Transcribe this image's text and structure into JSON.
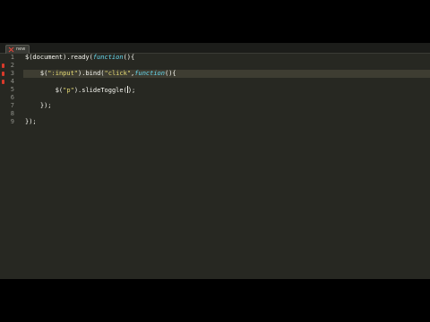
{
  "tab": {
    "label": "new"
  },
  "editor": {
    "colors": {
      "background": "#272822",
      "text": "#f8f8f2",
      "string": "#e6db74",
      "keyword": "#66d9ef",
      "line_number": "#8f908a",
      "marker": "#d93a2b",
      "current_line": "#3e3d32"
    },
    "current_line": 3,
    "lines": [
      {
        "number": "1",
        "has_marker": false,
        "tokens": [
          {
            "t": "$(document).ready(",
            "c": "plain"
          },
          {
            "t": "function",
            "c": "kw"
          },
          {
            "t": "(){",
            "c": "plain"
          }
        ]
      },
      {
        "number": "2",
        "has_marker": true,
        "tokens": []
      },
      {
        "number": "3",
        "has_marker": true,
        "tokens": [
          {
            "t": "    $(",
            "c": "plain"
          },
          {
            "t": "\":input\"",
            "c": "str"
          },
          {
            "t": ").bind(",
            "c": "plain"
          },
          {
            "t": "\"click\"",
            "c": "str"
          },
          {
            "t": ",",
            "c": "plain"
          },
          {
            "t": "function",
            "c": "kw"
          },
          {
            "t": "(){",
            "c": "plain"
          }
        ]
      },
      {
        "number": "4",
        "has_marker": true,
        "tokens": []
      },
      {
        "number": "5",
        "has_marker": false,
        "tokens": [
          {
            "t": "        $(",
            "c": "plain"
          },
          {
            "t": "\"p\"",
            "c": "str"
          },
          {
            "t": ").slideToggle(",
            "c": "plain"
          },
          {
            "t": "",
            "c": "caret"
          },
          {
            "t": ");",
            "c": "plain"
          }
        ]
      },
      {
        "number": "6",
        "has_marker": false,
        "tokens": []
      },
      {
        "number": "7",
        "has_marker": false,
        "tokens": [
          {
            "t": "    });",
            "c": "plain"
          }
        ]
      },
      {
        "number": "8",
        "has_marker": false,
        "tokens": []
      },
      {
        "number": "9",
        "has_marker": false,
        "tokens": [
          {
            "t": "});",
            "c": "plain"
          }
        ]
      }
    ]
  }
}
